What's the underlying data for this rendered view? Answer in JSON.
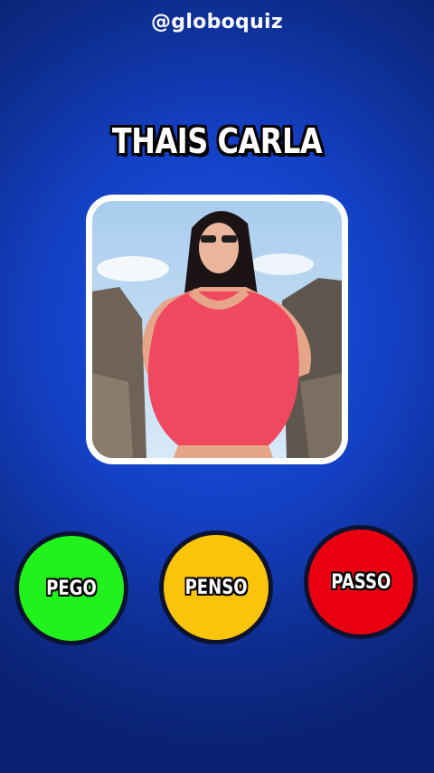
{
  "header": {
    "handle": "@globoquiz"
  },
  "quiz": {
    "celebrity_name": "THAIS CARLA",
    "photo_icon": "celebrity-photo"
  },
  "choices": [
    {
      "label": "PEGO",
      "color": "#22f21c"
    },
    {
      "label": "PENSO",
      "color": "#fcc409"
    },
    {
      "label": "PASSO",
      "color": "#e8000e"
    }
  ],
  "colors": {
    "background": "#1440c4",
    "frame": "#ffffff",
    "outline": "#0c1330"
  }
}
